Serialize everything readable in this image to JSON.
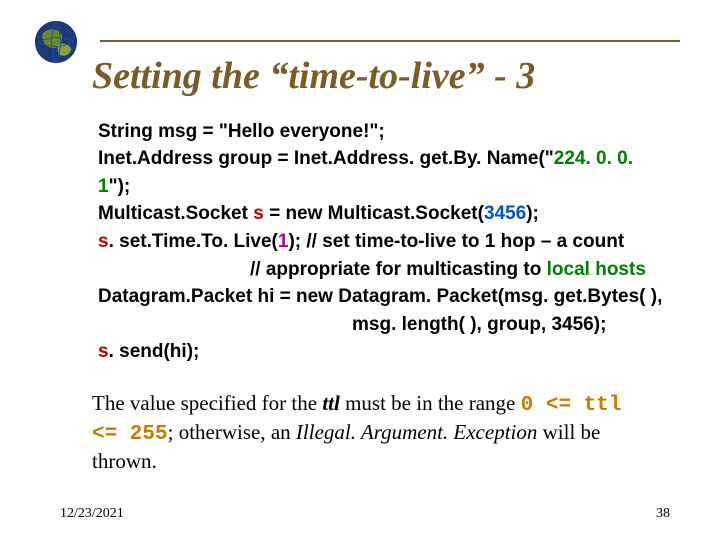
{
  "title": "Setting the “time-to-live” - 3",
  "code": {
    "l1_a": "String msg = \"Hello everyone!\";",
    "l2_a": "Inet.Address group = Inet.Address. get.By. Name(\"",
    "l2_ip": "224. 0. 0. 1",
    "l2_b": "\");",
    "l3_a": "Multicast.Socket ",
    "l3_s": "s",
    "l3_b": " = new Multicast.Socket(",
    "l3_port": "3456",
    "l3_c": ");",
    "l4_s": "s",
    "l4_a": ". set.Time.To. Live(",
    "l4_one": "1",
    "l4_b": ");   // set time-to-live to 1 hop – a count",
    "l5_a": "// appropriate for  multicasting to ",
    "l5_lh": "local hosts",
    "l6_a": "Datagram.Packet hi = new Datagram. Packet(msg. get.Bytes( ),",
    "l7_a": "msg. length( ), group, 3456);",
    "l8_s": "s",
    "l8_a": ". send(hi);"
  },
  "para": {
    "a": "The value specified for the ",
    "ttl": "ttl",
    "b": " must be in the range ",
    "range": "0 <= ttl <= 255",
    "c": "; otherwise, an ",
    "ex": "Illegal. Argument. Exception",
    "d": " will be thrown."
  },
  "footer": {
    "date": "12/23/2021",
    "page": "38"
  }
}
